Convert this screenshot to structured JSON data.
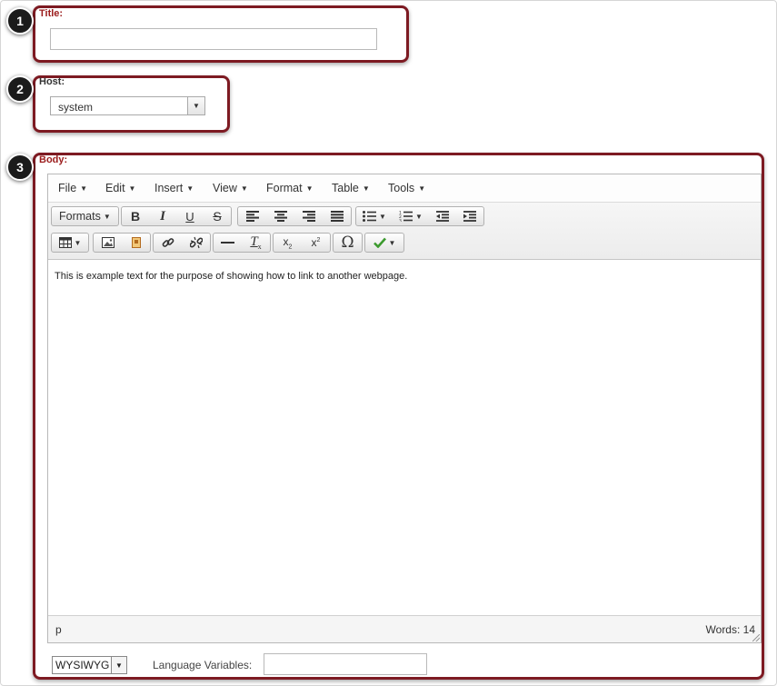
{
  "steps": [
    "1",
    "2",
    "3"
  ],
  "title_field": {
    "label": "Title:",
    "value": "",
    "placeholder": ""
  },
  "host_field": {
    "label": "Host:",
    "selected": "system"
  },
  "body_field": {
    "label": "Body:"
  },
  "editor": {
    "menus": [
      "File",
      "Edit",
      "Insert",
      "View",
      "Format",
      "Table",
      "Tools"
    ],
    "formats_label": "Formats",
    "content_text": "This is example text for the purpose of showing how to link to another webpage.",
    "status_path": "p",
    "word_count": "Words: 14"
  },
  "footer": {
    "mode_selected": "WYSIWYG",
    "language_label": "Language Variables:",
    "language_value": ""
  },
  "colors": {
    "callout_border": "#7d1a22",
    "label_red": "#9b1c1c",
    "check_green": "#3c9a2e"
  },
  "icons": [
    "bold-icon",
    "italic-icon",
    "underline-icon",
    "strikethrough-icon",
    "align-left-icon",
    "align-center-icon",
    "align-right-icon",
    "justify-icon",
    "bullet-list-icon",
    "numbered-list-icon",
    "outdent-icon",
    "indent-icon",
    "table-icon",
    "image-icon",
    "media-icon",
    "link-icon",
    "unlink-icon",
    "horizontal-rule-icon",
    "clear-format-icon",
    "subscript-icon",
    "superscript-icon",
    "omega-icon",
    "spellcheck-icon"
  ]
}
